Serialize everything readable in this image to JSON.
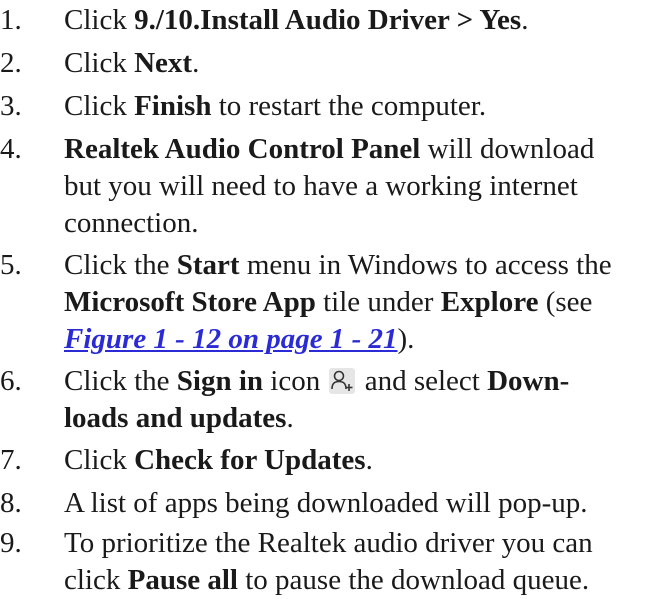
{
  "steps": [
    {
      "number": "1.",
      "click": "Click ",
      "target": "9./10.Install Audio Driver > Yes",
      "end": "."
    },
    {
      "number": "2.",
      "click": "Click ",
      "target": "Next",
      "end": "."
    },
    {
      "number": "3.",
      "click": "Click ",
      "target": "Finish",
      "rest": " to restart the computer."
    },
    {
      "number": "4.",
      "target": "Realtek Audio Control Panel",
      "rest1": " will download",
      "line2": "but you will need to have a working internet",
      "line3": "connection."
    },
    {
      "number": "5.",
      "click": "Click the ",
      "start": "Start",
      "rest1": " menu in Windows to access the",
      "store": "Microsoft Store App",
      "tile": " tile under ",
      "explore": "Explore",
      "see": " (see",
      "ref": "Figure 1 - 12 on page 1 - 21",
      "close": ")."
    },
    {
      "number": "6.",
      "click": "Click the ",
      "signin": "Sign in",
      "icon_word": " icon ",
      "icon": "person-add-icon",
      "select": " and select ",
      "down1": "Down-",
      "down2": "loads and updates",
      "end": "."
    },
    {
      "number": "7.",
      "click": "Click ",
      "target": "Check for Updates",
      "end": "."
    },
    {
      "number": "8.",
      "text": "A list of apps being downloaded will pop-up."
    },
    {
      "number": "9.",
      "line1": "To prioritize the Realtek audio driver you can",
      "click": "click ",
      "target": "Pause all",
      "rest": " to pause the download queue."
    }
  ]
}
